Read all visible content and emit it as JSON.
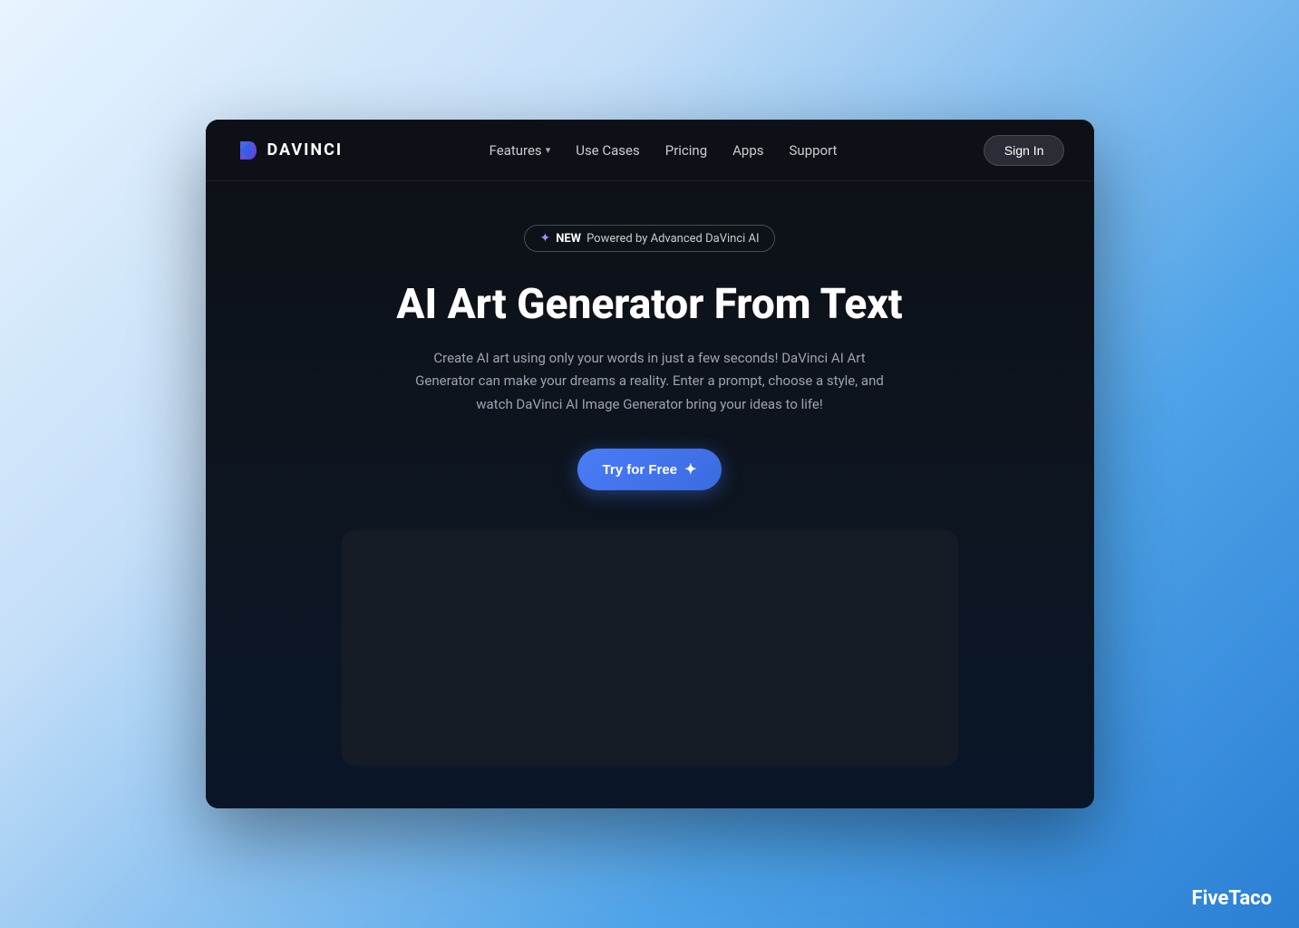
{
  "browser": {
    "background_color": "#0d1117"
  },
  "navbar": {
    "logo_text": "DAVINCI",
    "nav_items": [
      {
        "label": "Features",
        "has_dropdown": true
      },
      {
        "label": "Use Cases",
        "has_dropdown": false
      },
      {
        "label": "Pricing",
        "has_dropdown": false
      },
      {
        "label": "Apps",
        "has_dropdown": false
      },
      {
        "label": "Support",
        "has_dropdown": false
      }
    ],
    "sign_in_label": "Sign In"
  },
  "hero": {
    "badge_new": "NEW",
    "badge_text": "Powered by Advanced DaVinci AI",
    "heading": "AI Art Generator From Text",
    "subtext": "Create AI art using only your words in just a few seconds! DaVinci AI Art Generator can make your dreams a reality. Enter a prompt, choose a style, and watch DaVinci AI Image Generator bring your ideas to life!",
    "cta_label": "Try for Free"
  },
  "watermark": {
    "text": "FiveTaco"
  }
}
